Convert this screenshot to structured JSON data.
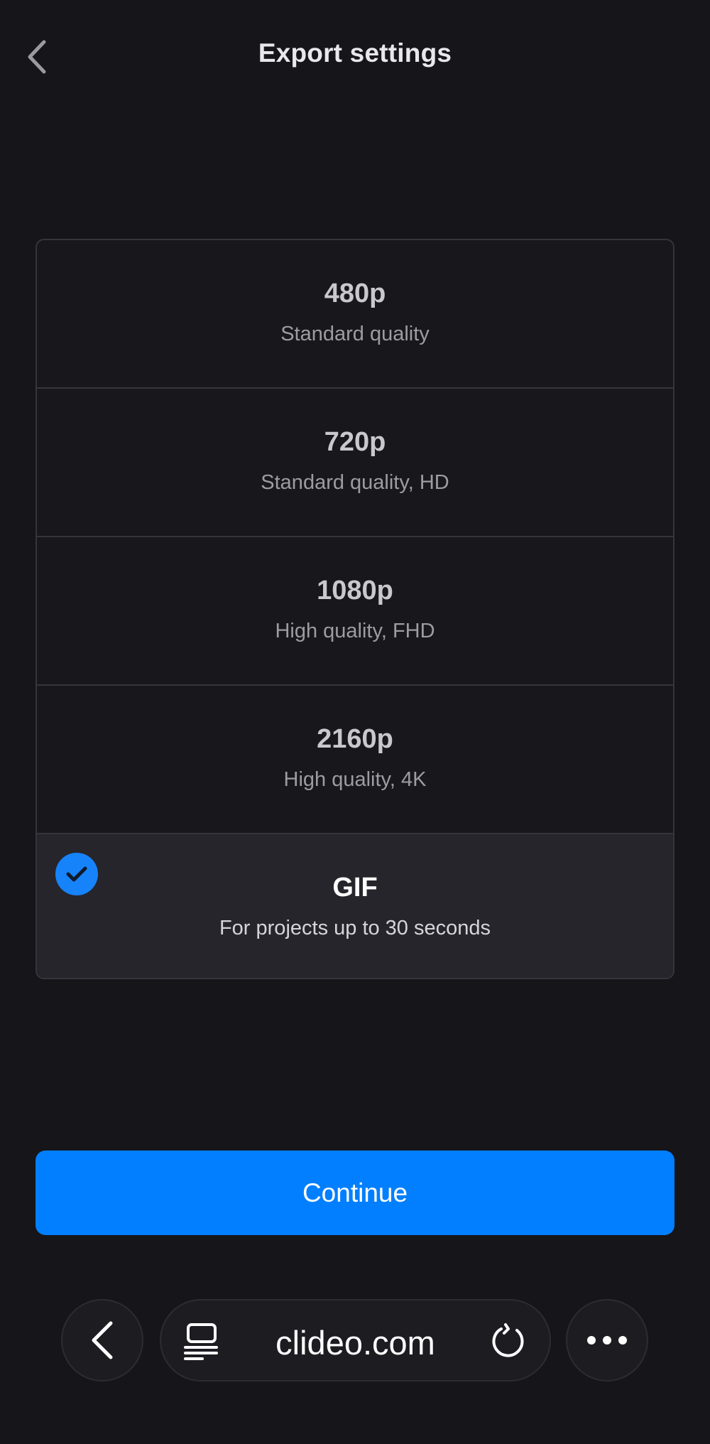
{
  "header": {
    "title": "Export settings",
    "back_icon": "chevron-left-icon"
  },
  "options": [
    {
      "title": "480p",
      "subtitle": "Standard quality",
      "selected": false
    },
    {
      "title": "720p",
      "subtitle": "Standard quality, HD",
      "selected": false
    },
    {
      "title": "1080p",
      "subtitle": "High quality, FHD",
      "selected": false
    },
    {
      "title": "2160p",
      "subtitle": "High quality, 4K",
      "selected": false
    },
    {
      "title": "GIF",
      "subtitle": "For projects up to 30 seconds",
      "selected": true
    }
  ],
  "continue_label": "Continue",
  "browser": {
    "url": "clideo.com",
    "back_icon": "chevron-left-icon",
    "tabs_icon": "tabs-icon",
    "reload_icon": "reload-icon",
    "more_icon": "more-dots-icon"
  },
  "colors": {
    "background": "#16151a",
    "accent": "#017ffe",
    "selected_row": "#26252b",
    "border": "#36353c"
  }
}
